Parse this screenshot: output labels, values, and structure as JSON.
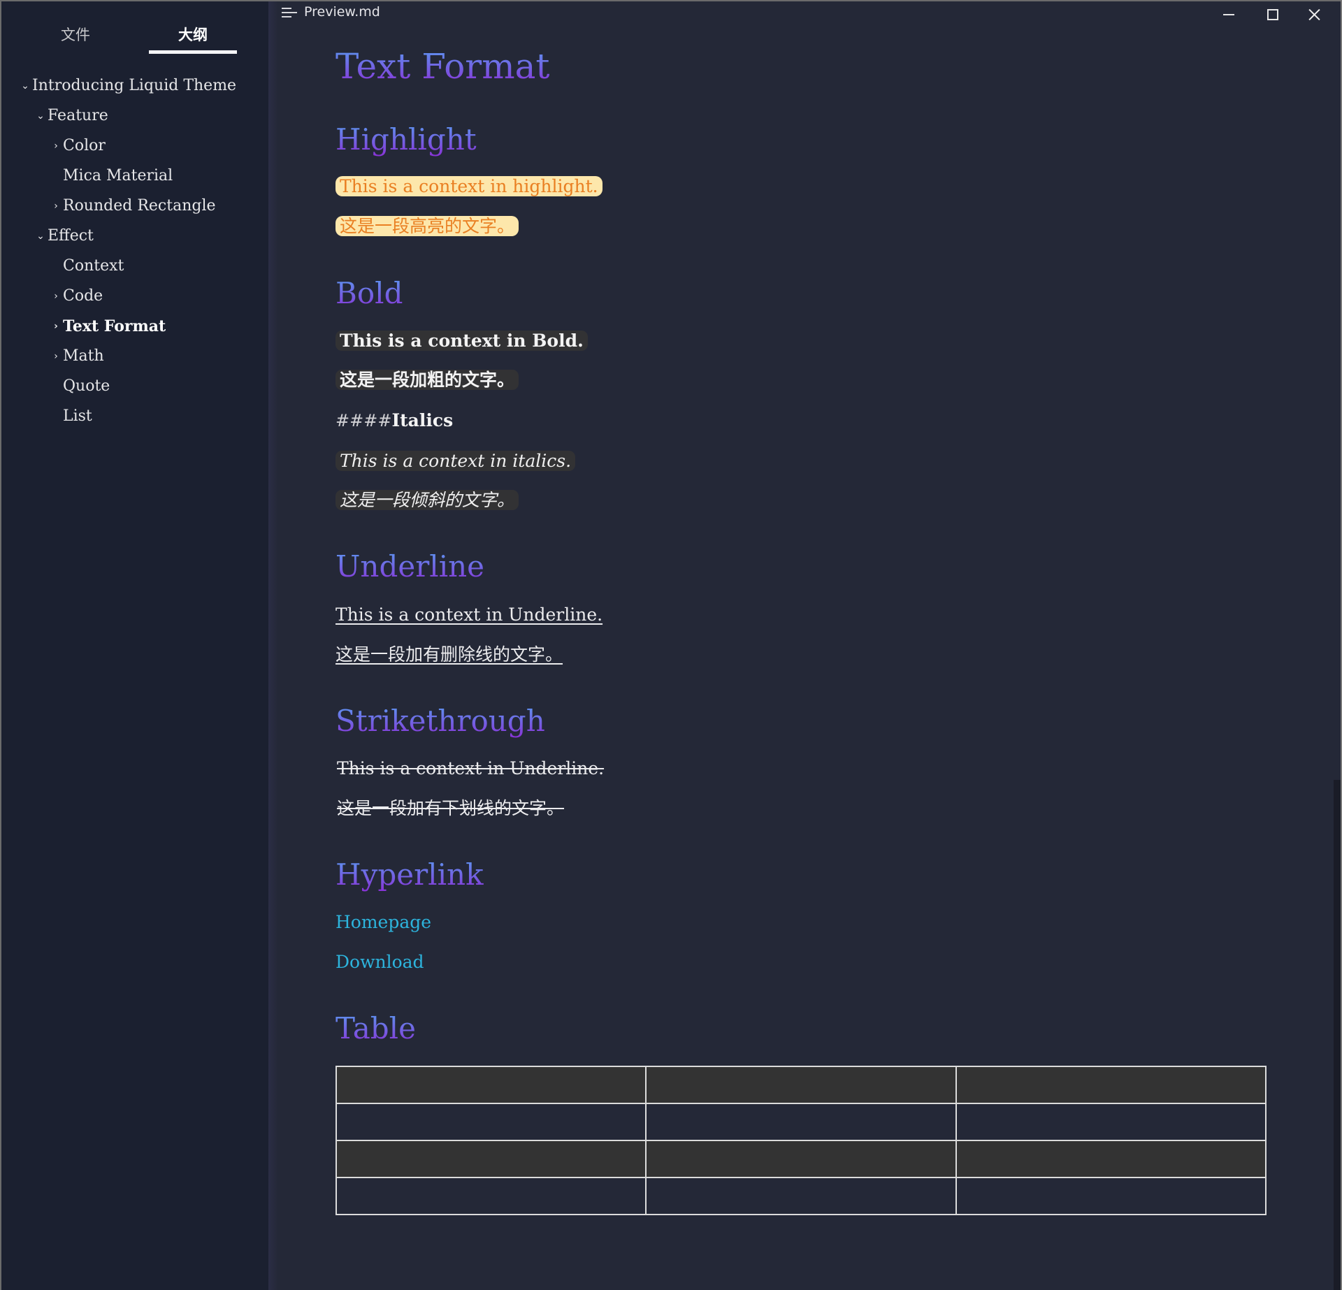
{
  "window": {
    "title": "Preview.md",
    "menu_icon": "hamburger-menu-icon",
    "controls": [
      "minimize-icon",
      "maximize-icon",
      "close-icon"
    ]
  },
  "sidebar": {
    "tabs": [
      {
        "label": "文件",
        "active": false
      },
      {
        "label": "大纲",
        "active": true
      }
    ],
    "outline": [
      {
        "label": "Introducing Liquid Theme",
        "level": 0,
        "toggle": "chevron-down"
      },
      {
        "label": "Feature",
        "level": 1,
        "toggle": "chevron-down"
      },
      {
        "label": "Color",
        "level": 2,
        "toggle": "chevron-right"
      },
      {
        "label": "Mica Material",
        "level": 2,
        "toggle": "none"
      },
      {
        "label": "Rounded Rectangle",
        "level": 2,
        "toggle": "chevron-right"
      },
      {
        "label": "Effect",
        "level": 1,
        "toggle": "chevron-down"
      },
      {
        "label": "Context",
        "level": 2,
        "toggle": "none"
      },
      {
        "label": "Code",
        "level": 2,
        "toggle": "chevron-right"
      },
      {
        "label": "Text Format",
        "level": 2,
        "toggle": "chevron-right",
        "active": true
      },
      {
        "label": "Math",
        "level": 2,
        "toggle": "chevron-right"
      },
      {
        "label": "Quote",
        "level": 2,
        "toggle": "none"
      },
      {
        "label": "List",
        "level": 2,
        "toggle": "none"
      }
    ]
  },
  "document": {
    "title": "Text Format",
    "highlight": {
      "heading": "Highlight",
      "lines": [
        "This is a context in highlight.",
        "这是一段高亮的文字。"
      ]
    },
    "bold": {
      "heading": "Bold",
      "lines": [
        "This is a context in Bold.",
        "这是一段加粗的文字。"
      ]
    },
    "italics": {
      "heading_marks": "####",
      "heading": "Italics",
      "lines": [
        "This is a context in italics.",
        "这是一段倾斜的文字。"
      ]
    },
    "underline": {
      "heading": "Underline",
      "lines": [
        "This is a context in Underline.",
        "这是一段加有删除线的文字。"
      ]
    },
    "strikethrough": {
      "heading": "Strikethrough",
      "lines": [
        "This is a context in Underline.",
        "这是一段加有下划线的文字。"
      ]
    },
    "hyperlink": {
      "heading": "Hyperlink",
      "links": [
        "Homepage",
        "Download"
      ]
    },
    "table": {
      "heading": "Table",
      "columns": 3,
      "rows": [
        [
          "",
          "",
          ""
        ],
        [
          "",
          "",
          ""
        ],
        [
          "",
          "",
          ""
        ],
        [
          "",
          "",
          ""
        ]
      ]
    }
  },
  "colors": {
    "sidebar_bg": "#1b2030",
    "content_bg": "#242837",
    "heading_gradient": [
      "#5c95f0",
      "#8a2fd6"
    ],
    "highlight_bg": "#fde7ab",
    "highlight_text": "#e97f22",
    "chip_bg": "#323234",
    "link": "#2db4dd",
    "table_alt_row": "#333333"
  }
}
